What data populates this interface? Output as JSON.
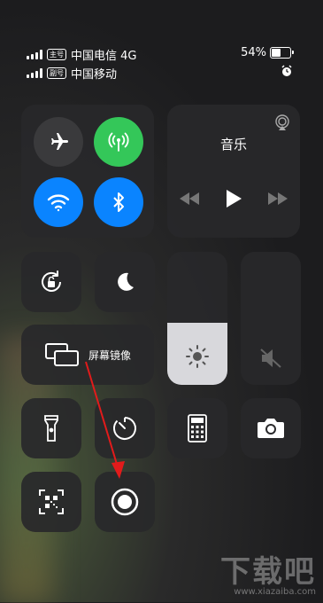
{
  "status_bar": {
    "sim1": {
      "badge": "主号",
      "carrier": "中国电信 4G"
    },
    "sim2": {
      "badge": "副号",
      "carrier": "中国移动"
    },
    "battery_percent": "54%",
    "battery_level": 0.54
  },
  "connectivity": {
    "airplane": {
      "icon": "airplane-icon",
      "on": false
    },
    "cellular": {
      "icon": "cellular-antenna-icon",
      "on": true,
      "color": "#34c759"
    },
    "wifi": {
      "icon": "wifi-icon",
      "on": true,
      "color": "#0a84ff"
    },
    "bluetooth": {
      "icon": "bluetooth-icon",
      "on": true,
      "color": "#0a84ff"
    }
  },
  "music": {
    "title": "音乐"
  },
  "screen_mirroring": {
    "label": "屏幕镜像"
  },
  "brightness": {
    "level": 0.47
  },
  "volume": {
    "muted": true
  },
  "watermark": {
    "logo": "下载吧",
    "url": "www.xiazaiba.com"
  }
}
